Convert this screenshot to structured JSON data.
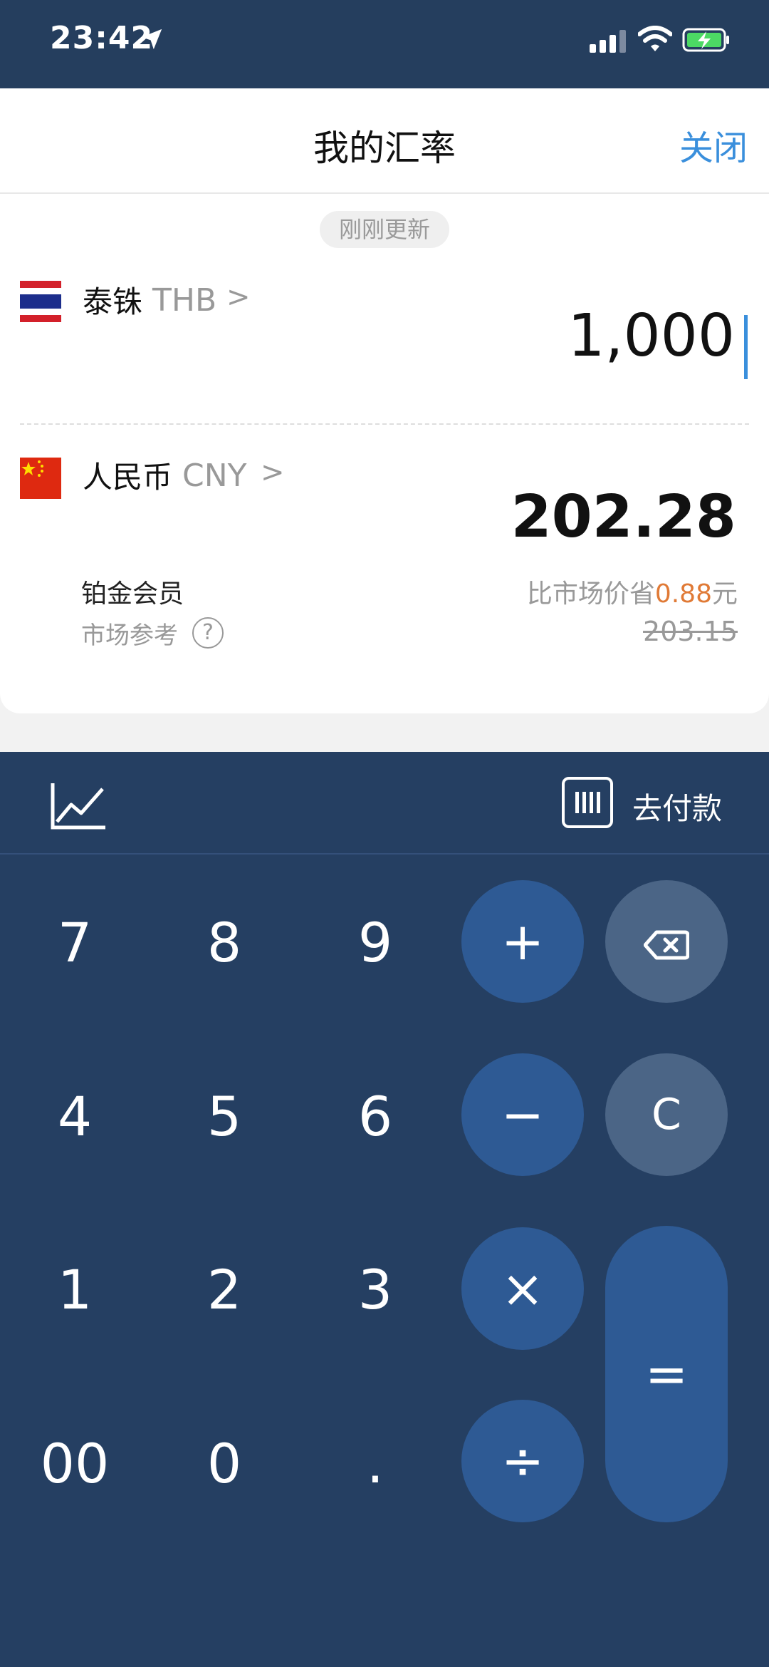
{
  "status_bar": {
    "time": "23:42"
  },
  "header": {
    "title": "我的汇率",
    "close_label": "关闭"
  },
  "update_status": "刚刚更新",
  "source_currency": {
    "name": "泰铢",
    "code": "THB",
    "amount": "1,000"
  },
  "target_currency": {
    "name": "人民币",
    "code": "CNY",
    "amount": "202.28"
  },
  "membership": {
    "label": "铂金会员",
    "market_ref_label": "市场参考",
    "save_prefix": "比市场价省",
    "save_amount": "0.88",
    "save_unit": "元",
    "market_price": "203.15"
  },
  "toolbar": {
    "pay_label": "去付款"
  },
  "keypad": {
    "digits": [
      "7",
      "8",
      "9",
      "4",
      "5",
      "6",
      "1",
      "2",
      "3",
      "00",
      "0",
      "."
    ],
    "ops": {
      "plus": "+",
      "minus": "−",
      "times": "×",
      "divide": "÷",
      "clear": "C",
      "equals": "="
    }
  },
  "colors": {
    "accent": "#3a8fdc",
    "keypad_bg": "#253f62",
    "op_button": "#2e5a94",
    "save_highlight": "#e07a36"
  }
}
